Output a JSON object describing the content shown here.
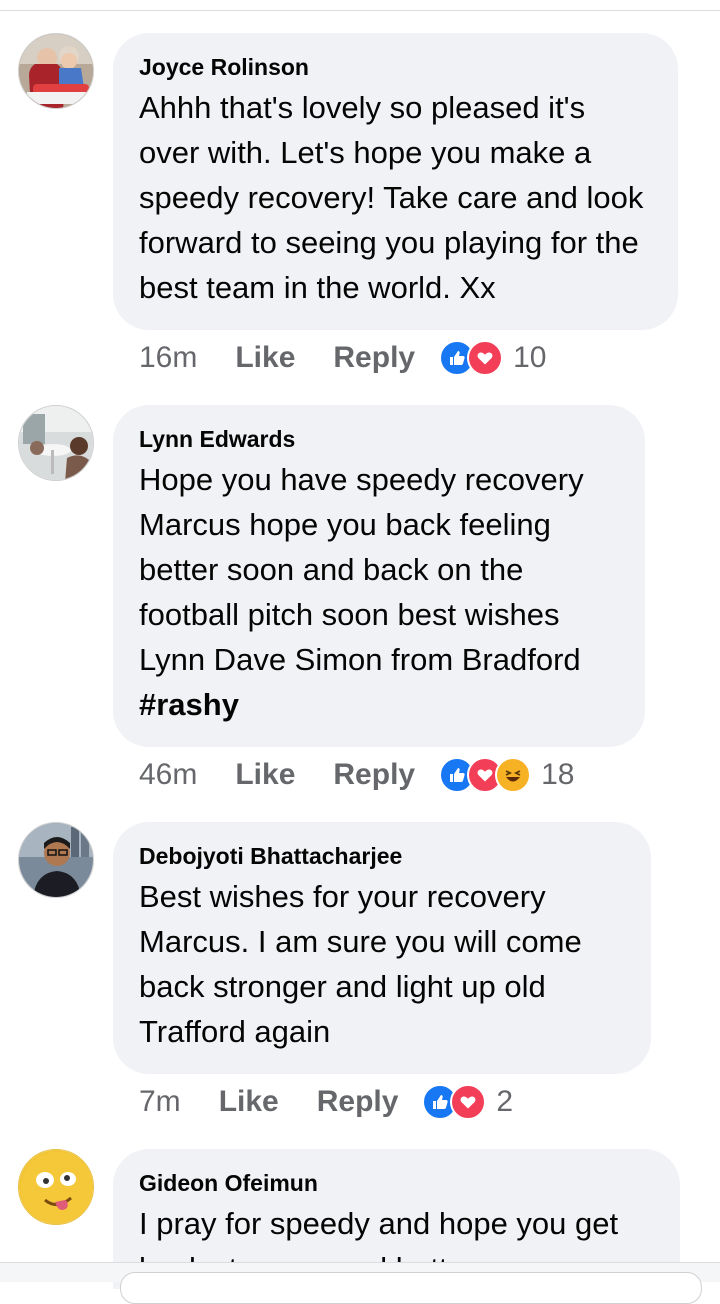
{
  "comments": [
    {
      "author": "Joyce Rolinson",
      "text": "Ahhh that's lovely so pleased it's over with. Let's hope you make a speedy recovery! Take care and look forward to seeing you playing for the best team in the world. Xx",
      "time": "16m",
      "like_label": "Like",
      "reply_label": "Reply",
      "reaction_icons": [
        "like-reaction-icon",
        "love-reaction-icon"
      ],
      "reaction_count": "10"
    },
    {
      "author": "Lynn Edwards",
      "text": "Hope you have speedy recovery Marcus hope you back feeling better soon and back on the football pitch soon best wishes Lynn Dave Simon from Bradford",
      "hashtag": "#rashy",
      "time": "46m",
      "like_label": "Like",
      "reply_label": "Reply",
      "reaction_icons": [
        "like-reaction-icon",
        "love-reaction-icon",
        "haha-reaction-icon"
      ],
      "reaction_count": "18"
    },
    {
      "author": "Debojyoti Bhattacharjee",
      "text": "Best wishes for your recovery Marcus. I am sure you will come back stronger and light up old Trafford again",
      "time": "7m",
      "like_label": "Like",
      "reply_label": "Reply",
      "reaction_icons": [
        "like-reaction-icon",
        "love-reaction-icon"
      ],
      "reaction_count": "2"
    },
    {
      "author": "Gideon Ofeimun",
      "text": "I pray for speedy and hope you get back stronger and better"
    }
  ],
  "colors": {
    "bubble": "#f0f2f5",
    "meta_text": "#65676b",
    "like_blue": "#1877f2",
    "love_red": "#f33e58",
    "haha_yellow": "#f7b125"
  }
}
